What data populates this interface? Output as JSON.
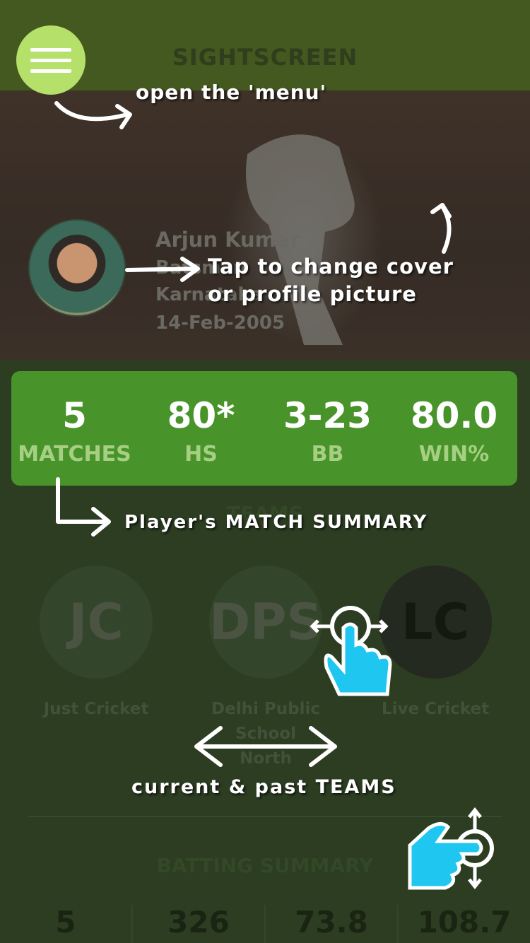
{
  "app": {
    "title": "SIGHTSCREEN"
  },
  "profile": {
    "name": "Arjun Kumar",
    "role": "Batsman",
    "state": "Karnataka",
    "dob": "14-Feb-2005"
  },
  "stats": [
    {
      "value": "5",
      "label": "MATCHES"
    },
    {
      "value": "80*",
      "label": "HS"
    },
    {
      "value": "3-23",
      "label": "BB"
    },
    {
      "value": "80.0",
      "label": "WIN%"
    }
  ],
  "teams": {
    "title": "TEAMS",
    "items": [
      {
        "initials": "JC",
        "name": "Just Cricket"
      },
      {
        "initials": "DPS",
        "name": "Delhi Public School North"
      },
      {
        "initials": "LC",
        "name": "Live Cricket"
      }
    ]
  },
  "batting": {
    "title": "BATTING SUMMARY",
    "values": [
      "5",
      "326",
      "73.8",
      "108.7"
    ]
  },
  "annotations": {
    "menu": "open the 'menu'",
    "cover_line1": "Tap to change cover",
    "cover_line2": "or profile picture",
    "summary": "Player's MATCH SUMMARY",
    "teams": "current & past TEAMS"
  },
  "colors": {
    "accent_green": "#48942a",
    "menu_button": "#b5e06a",
    "gesture_hand": "#1fc6f0",
    "stat_label": "#a6cf84"
  },
  "icons": [
    "menu-icon",
    "swipe-horizontal-hand-icon",
    "scroll-vertical-hand-icon"
  ]
}
